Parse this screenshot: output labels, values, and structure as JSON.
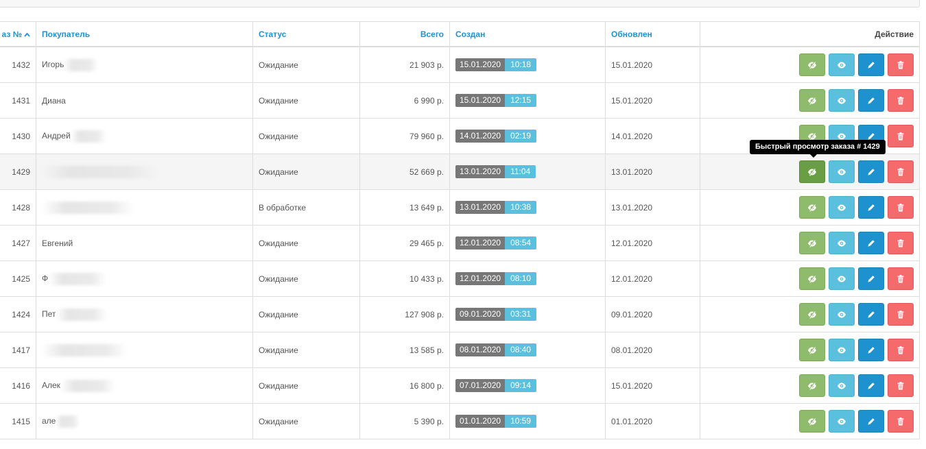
{
  "columns": {
    "order_id": "аз №",
    "order_id_sort_icon": "caret-up-icon",
    "customer": "Покупатель",
    "status": "Статус",
    "total": "Всего",
    "created": "Создан",
    "updated": "Обновлен",
    "action": "Действие"
  },
  "rows": [
    {
      "id": "1432",
      "customer": "Игорь",
      "status": "Ожидание",
      "total": "21 903 р.",
      "created_date": "15.01.2020",
      "created_time": "10:18",
      "updated": "15.01.2020"
    },
    {
      "id": "1431",
      "customer": "Диана",
      "status": "Ожидание",
      "total": "6 990 р.",
      "created_date": "15.01.2020",
      "created_time": "12:15",
      "updated": "15.01.2020"
    },
    {
      "id": "1430",
      "customer": "Андрей",
      "status": "Ожидание",
      "total": "79 960 р.",
      "created_date": "14.01.2020",
      "created_time": "02:19",
      "updated": "14.01.2020"
    },
    {
      "id": "1429",
      "customer": "",
      "status": "Ожидание",
      "total": "52 669 р.",
      "created_date": "13.01.2020",
      "created_time": "11:04",
      "updated": "13.01.2020"
    },
    {
      "id": "1428",
      "customer": "",
      "status": "В обработке",
      "total": "13 649 р.",
      "created_date": "13.01.2020",
      "created_time": "10:38",
      "updated": "13.01.2020"
    },
    {
      "id": "1427",
      "customer": "Евгений",
      "status": "Ожидание",
      "total": "29 465 р.",
      "created_date": "12.01.2020",
      "created_time": "08:54",
      "updated": "12.01.2020"
    },
    {
      "id": "1425",
      "customer": "Ф",
      "status": "Ожидание",
      "total": "10 433 р.",
      "created_date": "12.01.2020",
      "created_time": "08:10",
      "updated": "12.01.2020"
    },
    {
      "id": "1424",
      "customer": "Пет",
      "status": "Ожидание",
      "total": "127 908 р.",
      "created_date": "09.01.2020",
      "created_time": "03:31",
      "updated": "09.01.2020"
    },
    {
      "id": "1417",
      "customer": "",
      "status": "Ожидание",
      "total": "13 585 р.",
      "created_date": "08.01.2020",
      "created_time": "08:40",
      "updated": "08.01.2020"
    },
    {
      "id": "1416",
      "customer": "Алек",
      "status": "Ожидание",
      "total": "16 800 р.",
      "created_date": "07.01.2020",
      "created_time": "09:14",
      "updated": "15.01.2020"
    },
    {
      "id": "1415",
      "customer": "але",
      "status": "Ожидание",
      "total": "5 390 р.",
      "created_date": "01.01.2020",
      "created_time": "10:59",
      "updated": "01.01.2020"
    }
  ],
  "tooltip": "Быстрый просмотр заказа # 1429",
  "icons": {
    "quick_view": "eye-slash-icon",
    "view": "eye-icon",
    "edit": "pencil-icon",
    "delete": "trash-icon"
  },
  "colors": {
    "header_link": "#1e91cf",
    "quick_view_button": "#8fbb6c",
    "view_button": "#5bc0de",
    "edit_button": "#1e91cf",
    "delete_button": "#f56b6b",
    "date_badge": "#777777",
    "time_badge": "#5bc0de"
  }
}
